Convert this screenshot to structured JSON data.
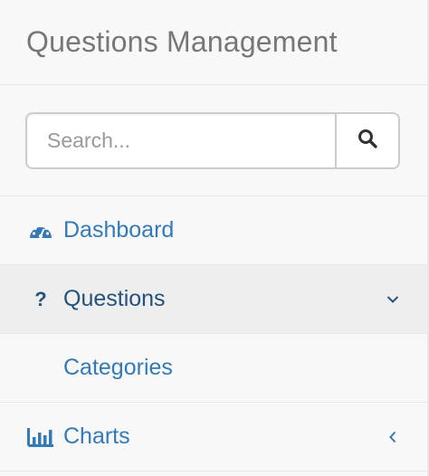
{
  "brand": {
    "title": "Questions Management"
  },
  "search": {
    "placeholder": "Search...",
    "button_icon": "search-icon"
  },
  "nav": {
    "items": [
      {
        "label": "Dashboard",
        "icon": "dashboard-icon",
        "active": false
      },
      {
        "label": "Questions",
        "icon": "question-icon",
        "active": true,
        "arrow": "chevron-down-icon"
      },
      {
        "label": "Categories",
        "sub": true
      },
      {
        "label": "Charts",
        "icon": "bar-chart-icon",
        "arrow": "chevron-left-icon"
      }
    ]
  },
  "colors": {
    "link": "#337ab7",
    "link_active": "#23527c",
    "brand_text": "#777777",
    "background": "#f8f8f8",
    "active_background": "#eeeeee",
    "border": "#e7e7e7"
  }
}
